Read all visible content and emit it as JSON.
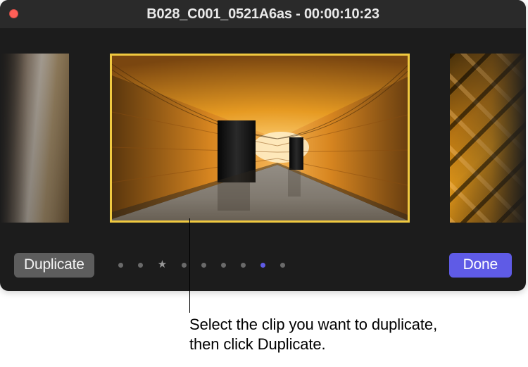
{
  "window": {
    "title": "B028_C001_0521A6as - 00:00:10:23",
    "close_color": "#ff5f57",
    "selection_color": "#f0c940"
  },
  "toolbar": {
    "duplicate_label": "Duplicate",
    "done_label": "Done",
    "done_color": "#5f5be6"
  },
  "dots": [
    {
      "type": "dot"
    },
    {
      "type": "dot"
    },
    {
      "type": "star"
    },
    {
      "type": "dot"
    },
    {
      "type": "dot"
    },
    {
      "type": "dot"
    },
    {
      "type": "dot"
    },
    {
      "type": "dot-blue"
    },
    {
      "type": "dot"
    }
  ],
  "callout": {
    "text": "Select the clip you want to duplicate, then click Duplicate."
  }
}
